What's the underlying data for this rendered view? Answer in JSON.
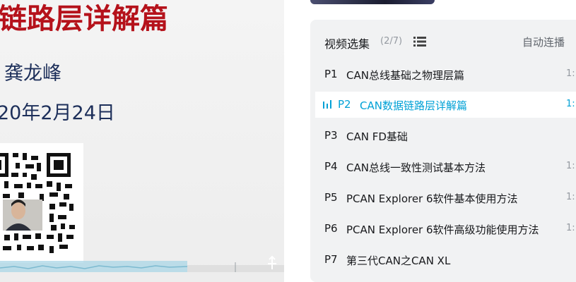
{
  "video": {
    "slide_title": "链路层详解篇",
    "slide_author": "龚龙峰",
    "slide_date": "20年2月24日"
  },
  "playlist": {
    "title": "视频选集",
    "count": "(2/7)",
    "autoplay_label": "自动连播",
    "episodes": [
      {
        "num": "P1",
        "title": "CAN总线基础之物理层篇",
        "duration": "1:",
        "active": false
      },
      {
        "num": "P2",
        "title": "CAN数据链路层详解篇",
        "duration": "1:",
        "active": true
      },
      {
        "num": "P3",
        "title": "CAN FD基础",
        "duration": "",
        "active": false
      },
      {
        "num": "P4",
        "title": "CAN总线一致性测试基本方法",
        "duration": "1:",
        "active": false
      },
      {
        "num": "P5",
        "title": "PCAN Explorer 6软件基本使用方法",
        "duration": "1:",
        "active": false
      },
      {
        "num": "P6",
        "title": "PCAN Explorer 6软件高级功能使用方法",
        "duration": "1:",
        "active": false
      },
      {
        "num": "P7",
        "title": "第三代CAN之CAN XL",
        "duration": "",
        "active": false
      }
    ]
  },
  "colors": {
    "accent": "#00a1d6",
    "slide_red": "#b5121b",
    "slide_navy": "#1d2f5a",
    "panel_bg": "#f1f2f3"
  },
  "icons": {
    "list": "list-icon",
    "playing": "playing-bars-icon",
    "drag": "drag-handle-icon"
  }
}
